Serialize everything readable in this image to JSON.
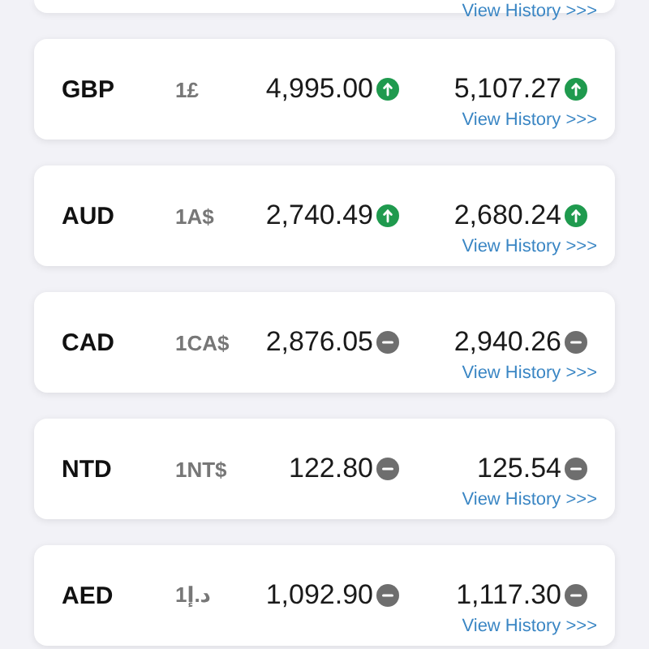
{
  "top_card": {
    "link": "View History >>>"
  },
  "rates": [
    {
      "code": "GBP",
      "unit": "1£",
      "buy": {
        "value": "4,995.00",
        "kind": "up"
      },
      "sell": {
        "value": "5,107.27",
        "kind": "up"
      },
      "link": "View History >>>"
    },
    {
      "code": "AUD",
      "unit": "1A$",
      "buy": {
        "value": "2,740.49",
        "kind": "up"
      },
      "sell": {
        "value": "2,680.24",
        "kind": "up"
      },
      "link": "View History >>>"
    },
    {
      "code": "CAD",
      "unit": "1CA$",
      "buy": {
        "value": "2,876.05",
        "kind": "flat"
      },
      "sell": {
        "value": "2,940.26",
        "kind": "flat"
      },
      "link": "View History >>>"
    },
    {
      "code": "NTD",
      "unit": "1NT$",
      "buy": {
        "value": "122.80",
        "kind": "flat"
      },
      "sell": {
        "value": "125.54",
        "kind": "flat"
      },
      "link": "View History >>>"
    },
    {
      "code": "AED",
      "unit": "1د.إ",
      "buy": {
        "value": "1,092.90",
        "kind": "flat"
      },
      "sell": {
        "value": "1,117.30",
        "kind": "flat"
      },
      "link": "View History >>>"
    }
  ]
}
